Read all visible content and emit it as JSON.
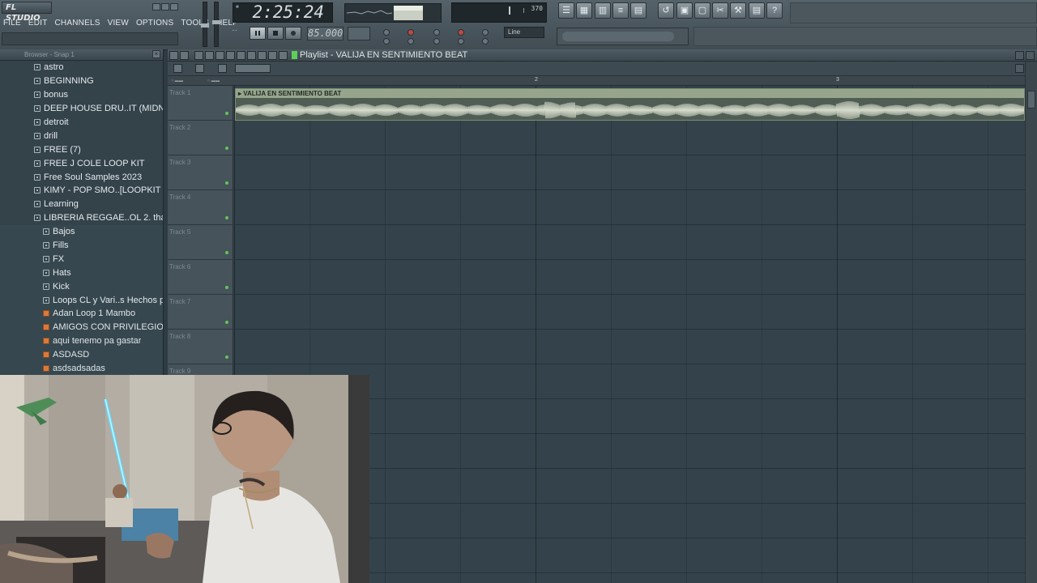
{
  "app": {
    "logo_text": "FL STUDIO",
    "menus": [
      "FILE",
      "EDIT",
      "CHANNELS",
      "VIEW",
      "OPTIONS",
      "TOOLS",
      "HELP"
    ]
  },
  "transport": {
    "time": "2:25:24",
    "tempo": "85.000",
    "cpu_readout": "370",
    "snap": "Line"
  },
  "browser": {
    "header": "Browser - Snap 1",
    "items": [
      {
        "label": "astro",
        "kind": "folder",
        "level": 0
      },
      {
        "label": "BEGINNING",
        "kind": "folder",
        "level": 0
      },
      {
        "label": "bonus",
        "kind": "folder",
        "level": 0
      },
      {
        "label": "DEEP HOUSE DRU..IT (MIDNIGHT)",
        "kind": "folder",
        "level": 0
      },
      {
        "label": "detroit",
        "kind": "folder",
        "level": 0
      },
      {
        "label": "drill",
        "kind": "folder",
        "level": 0
      },
      {
        "label": "FREE (7)",
        "kind": "folder",
        "level": 0
      },
      {
        "label": "FREE J COLE LOOP KIT",
        "kind": "folder",
        "level": 0
      },
      {
        "label": "Free Soul Samples 2023",
        "kind": "folder",
        "level": 0
      },
      {
        "label": "KIMY - POP SMO..[LOOPKIT 2021]",
        "kind": "folder",
        "level": 0
      },
      {
        "label": "Learning",
        "kind": "folder",
        "level": 0
      },
      {
        "label": "LIBRERIA REGGAE..OL 2. thatboyr",
        "kind": "folder",
        "level": 0
      },
      {
        "label": "Bajos",
        "kind": "folder",
        "level": 1
      },
      {
        "label": "Fills",
        "kind": "folder",
        "level": 1
      },
      {
        "label": "FX",
        "kind": "folder",
        "level": 1
      },
      {
        "label": "Hats",
        "kind": "folder",
        "level": 1
      },
      {
        "label": "Kick",
        "kind": "folder",
        "level": 1
      },
      {
        "label": "Loops CL y Vari..s Hechos por R",
        "kind": "folder",
        "level": 1
      },
      {
        "label": "Adan Loop 1 Mambo",
        "kind": "file",
        "level": 2
      },
      {
        "label": "AMIGOS CON PRIVILEGIOS BEAT",
        "kind": "file",
        "level": 2
      },
      {
        "label": "aqui tenemo pa gastar",
        "kind": "file",
        "level": 2
      },
      {
        "label": "ASDASD",
        "kind": "file",
        "level": 2
      },
      {
        "label": "asdsadsadas",
        "kind": "file",
        "level": 2
      }
    ]
  },
  "playlist": {
    "title": "Playlist - VALIJA EN SENTIMIENTO  BEAT",
    "bar_numbers": [
      "2",
      "3"
    ],
    "tracks": [
      "Track 1",
      "Track 2",
      "Track 3",
      "Track 4",
      "Track 5",
      "Track 6",
      "Track 7",
      "Track 8",
      "Track 9"
    ],
    "clip_title": "VALIJA EN SENTIMIENTO  BEAT"
  },
  "colors": {
    "accent_green": "#5fcf5a",
    "file_orange": "#d97a3b",
    "clip_header": "#97a58c"
  }
}
